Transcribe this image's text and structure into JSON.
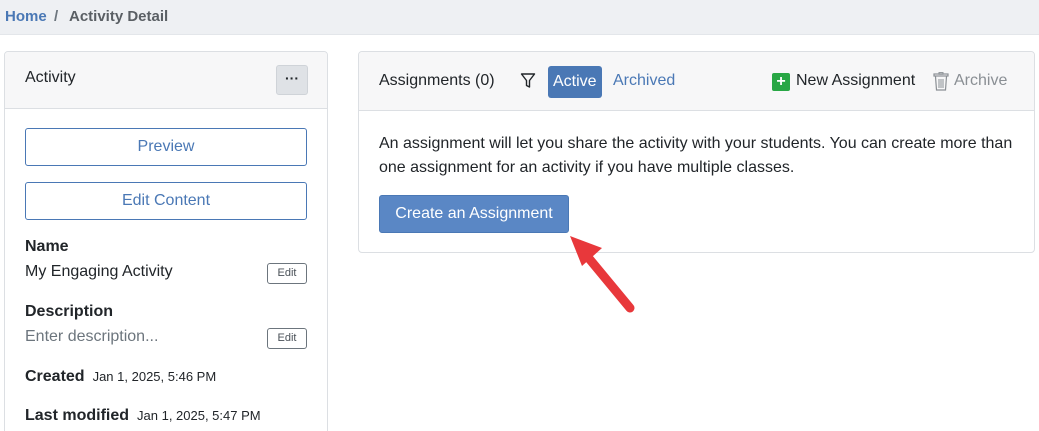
{
  "breadcrumb": {
    "home": "Home",
    "separator": "/",
    "current": "Activity Detail"
  },
  "activity_card": {
    "title": "Activity",
    "more_label": "···",
    "preview_label": "Preview",
    "edit_content_label": "Edit Content",
    "name_label": "Name",
    "name_value": "My Engaging Activity",
    "edit_label": "Edit",
    "description_label": "Description",
    "description_placeholder": "Enter description...",
    "created_label": "Created",
    "created_value": "Jan 1, 2025, 5:46 PM",
    "modified_label": "Last modified",
    "modified_value": "Jan 1, 2025, 5:47 PM"
  },
  "assignments_card": {
    "title": "Assignments (0)",
    "tab_active": "Active",
    "tab_archived": "Archived",
    "new_assignment_label": "New Assignment",
    "new_assignment_icon": "plus-icon",
    "archive_label": "Archive",
    "archive_icon": "trash-icon",
    "body_text": "An assignment will let you share the activity with your students. You can create more than one assignment for an activity if you have multiple classes.",
    "create_button_label": "Create an Assignment"
  },
  "colors": {
    "primary": "#4a78b5",
    "success": "#28a745",
    "annotation_arrow": "#e8383b"
  }
}
